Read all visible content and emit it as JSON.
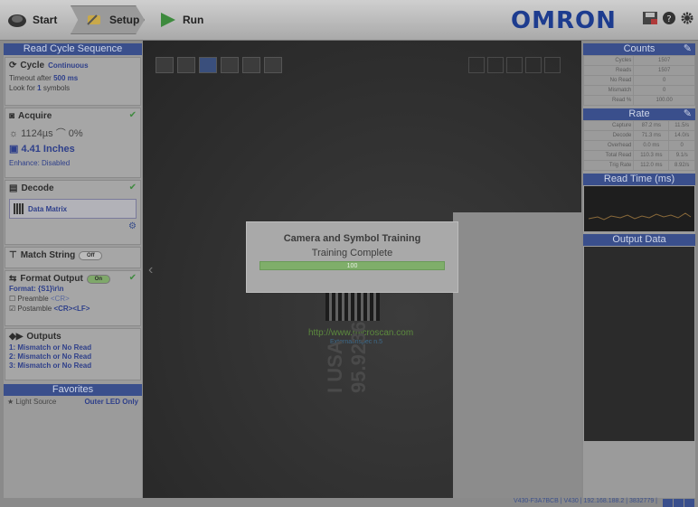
{
  "topbar": {
    "tabs": [
      "Start",
      "Setup",
      "Run"
    ],
    "logo": "OMRON"
  },
  "left": {
    "title": "Read Cycle Sequence",
    "cycle": {
      "label": "Cycle",
      "mode": "Continuous",
      "timeout_pre": "Timeout after",
      "timeout_val": "500 ms",
      "look_pre": "Look for",
      "look_val": "1",
      "look_post": "symbols"
    },
    "acquire": {
      "label": "Acquire",
      "exposure": "1124µs",
      "gain": "0%",
      "distance": "4.41 Inches",
      "enhance": "Enhance: Disabled"
    },
    "decode": {
      "label": "Decode",
      "symbol": "Data Matrix"
    },
    "match": {
      "label": "Match String",
      "toggle": "Off"
    },
    "format": {
      "label": "Format Output",
      "toggle": "On",
      "format": "Format: {S1}\\r\\n",
      "preamble_label": "Preamble",
      "preamble_val": "<CR>",
      "postamble_label": "Postamble",
      "postamble_val": "<CR><LF>"
    },
    "outputs": {
      "label": "Outputs",
      "items": [
        "1: Mismatch or No Read",
        "2: Mismatch or No Read",
        "3: Mismatch or No Read"
      ]
    },
    "favorites": {
      "title": "Favorites",
      "item_label": "Light Source",
      "item_value": "Outer LED Only"
    }
  },
  "center": {
    "url": "http://www.microscan.com",
    "url_sub": "ExternalInspec n.5",
    "label_line1": "I USA",
    "label_line2": "95.9236"
  },
  "dialog": {
    "title": "Camera and Symbol Training",
    "status": "Training Complete",
    "progress_text": "100",
    "progress": 1.0
  },
  "right": {
    "counts_title": "Counts",
    "counts": [
      {
        "k": "Cycles",
        "v": "1507"
      },
      {
        "k": "Reads",
        "v": "1507"
      },
      {
        "k": "No Read",
        "v": "0"
      },
      {
        "k": "Mismatch",
        "v": "0"
      },
      {
        "k": "Read %",
        "v": "100.00"
      }
    ],
    "rate_title": "Rate",
    "rate": [
      {
        "k": "Capture",
        "v1": "87.2 ms",
        "v2": "11.5/s"
      },
      {
        "k": "Decode",
        "v1": "71.3 ms",
        "v2": "14.0/s"
      },
      {
        "k": "Overhead",
        "v1": "0.0 ms",
        "v2": "0"
      },
      {
        "k": "Total Read",
        "v1": "110.3 ms",
        "v2": "9.1/s"
      },
      {
        "k": "Trig Rate",
        "v1": "112.0 ms",
        "v2": "8.92/s"
      }
    ],
    "readtime_title": "Read Time (ms)",
    "output_title": "Output Data"
  },
  "status": {
    "text": "V430-F3A7BCB | V430 | 192.168.188.2 | 3832779 |"
  }
}
